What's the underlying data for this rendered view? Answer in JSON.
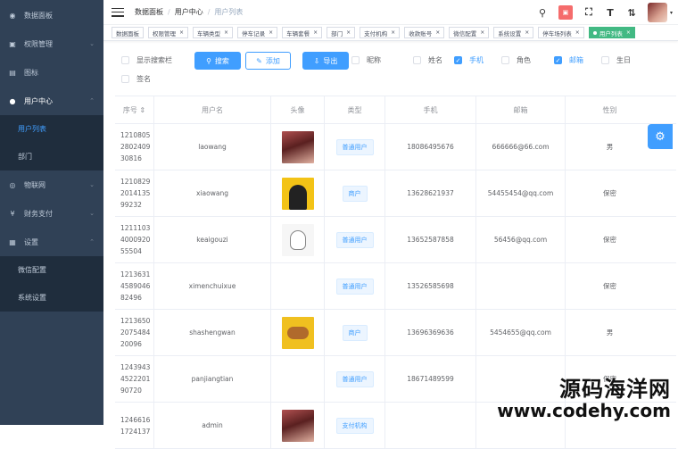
{
  "sidebar": {
    "items": [
      {
        "label": "数据面板",
        "icon": "dashboard-icon",
        "glyph": "◉"
      },
      {
        "label": "权限管理",
        "icon": "lock-icon",
        "glyph": "▣",
        "arrow": "⌄"
      },
      {
        "label": "图标",
        "icon": "picture-icon",
        "glyph": "▤"
      },
      {
        "label": "用户中心",
        "icon": "user-icon",
        "glyph": "●",
        "arrow": "⌃"
      },
      {
        "label": "用户列表"
      },
      {
        "label": "部门"
      },
      {
        "label": "物联网",
        "icon": "iot-icon",
        "glyph": "◎",
        "arrow": "⌄"
      },
      {
        "label": "财务支付",
        "icon": "yen-icon",
        "glyph": "¥",
        "arrow": "⌄"
      },
      {
        "label": "设置",
        "icon": "gear-icon",
        "glyph": "▦",
        "arrow": "⌃"
      },
      {
        "label": "微信配置"
      },
      {
        "label": "系统设置"
      }
    ]
  },
  "breadcrumb": [
    "数据面板",
    "用户中心",
    "用户列表"
  ],
  "topbar": {
    "search_glyph": "⚲",
    "badge_text": "▣",
    "fullscreen_glyph": "⛶",
    "font_glyph": "T",
    "size_glyph": "⇅",
    "caret": "▾"
  },
  "tags": [
    "数据面板",
    "权限管理",
    "车辆类型",
    "停车记录",
    "车辆套餐",
    "部门",
    "支付机构",
    "收款账号",
    "微信配置",
    "系统设置",
    "停车场列表",
    "用户列表"
  ],
  "tag_close": "×",
  "filters": {
    "show_search": "显示搜索栏",
    "search_button": "搜索",
    "add_button": "添加",
    "export_button": "导出",
    "search_glyph": "⚲",
    "add_glyph": "✎",
    "export_glyph": "⇩",
    "columns": [
      {
        "label": "昵称",
        "checked": false
      },
      {
        "label": "姓名",
        "checked": false
      },
      {
        "label": "手机",
        "checked": true
      },
      {
        "label": "角色",
        "checked": false
      },
      {
        "label": "邮箱",
        "checked": true
      },
      {
        "label": "生日",
        "checked": false
      },
      {
        "label": "签名",
        "checked": false
      }
    ],
    "check_glyph": "✓"
  },
  "table": {
    "headers": [
      "序号",
      "用户名",
      "头像",
      "类型",
      "手机",
      "邮箱",
      "性别"
    ],
    "sort_glyph": "⇕",
    "rows": [
      {
        "id": [
          "1210805",
          "2802409",
          "30816"
        ],
        "username": "laowang",
        "avatar": "red",
        "type": "普通用户",
        "phone": "18086495676",
        "email": "666666@66.com",
        "gender": "男"
      },
      {
        "id": [
          "1210829",
          "2014135",
          "99232"
        ],
        "username": "xiaowang",
        "avatar": "yellow",
        "type": "商户",
        "phone": "13628621937",
        "email": "54455454@qq.com",
        "gender": "保密"
      },
      {
        "id": [
          "1211103",
          "4000920",
          "55504"
        ],
        "username": "keaigouzi",
        "avatar": "sketch",
        "type": "普通用户",
        "phone": "13652587858",
        "email": "56456@qq.com",
        "gender": "保密"
      },
      {
        "id": [
          "1213631",
          "4589046",
          "82496"
        ],
        "username": "ximenchuixue",
        "avatar": "",
        "type": "普通用户",
        "phone": "13526585698",
        "email": "",
        "gender": "保密"
      },
      {
        "id": [
          "1213650",
          "2075484",
          "20096"
        ],
        "username": "shashengwan",
        "avatar": "bear",
        "type": "商户",
        "phone": "13696369636",
        "email": "5454655@qq.com",
        "gender": "男"
      },
      {
        "id": [
          "1243943",
          "4522201",
          "90720"
        ],
        "username": "panjiangtian",
        "avatar": "",
        "type": "普通用户",
        "phone": "18671489599",
        "email": "",
        "gender": "保密"
      },
      {
        "id": [
          "1246616",
          "1724137",
          ""
        ],
        "username": "admin",
        "avatar": "red",
        "type": "支付机构",
        "phone": "",
        "email": "",
        "gender": ""
      }
    ]
  },
  "settings_glyph": "⚙",
  "watermark": {
    "line1": "源码海洋网",
    "line2": "www.codehy.com"
  }
}
